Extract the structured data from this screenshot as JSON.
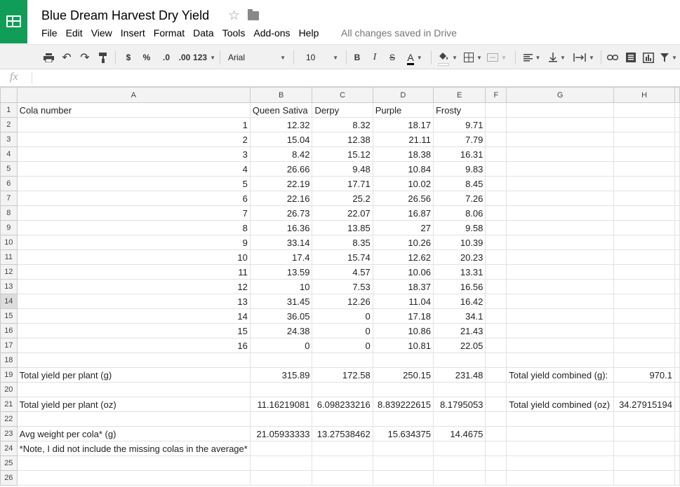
{
  "app": {
    "title": "Blue Dream Harvest Dry Yield",
    "save_status": "All changes saved in Drive"
  },
  "menu": [
    "File",
    "Edit",
    "View",
    "Insert",
    "Format",
    "Data",
    "Tools",
    "Add-ons",
    "Help"
  ],
  "toolbar": {
    "currency": "$",
    "percent": "%",
    "dec_less": ".0",
    "dec_more": ".00",
    "format_more": "123",
    "font": "Arial",
    "font_size": "10",
    "bold": "B",
    "italic": "I",
    "strike": "S",
    "text_color": "A",
    "text_color_value": "#000000"
  },
  "formula_bar": {
    "fx_label": "fx",
    "value": ""
  },
  "columns": [
    "A",
    "B",
    "C",
    "D",
    "E",
    "F",
    "G",
    "H"
  ],
  "rows": [
    {
      "n": "1",
      "cells": [
        "Cola number",
        "Queen Sativa",
        "Derpy",
        "Purple",
        "Frosty",
        "",
        "",
        ""
      ]
    },
    {
      "n": "2",
      "cells": [
        "1",
        "12.32",
        "8.32",
        "18.17",
        "9.71",
        "",
        "",
        ""
      ]
    },
    {
      "n": "3",
      "cells": [
        "2",
        "15.04",
        "12.38",
        "21.11",
        "7.79",
        "",
        "",
        ""
      ]
    },
    {
      "n": "4",
      "cells": [
        "3",
        "8.42",
        "15.12",
        "18.38",
        "16.31",
        "",
        "",
        ""
      ]
    },
    {
      "n": "5",
      "cells": [
        "4",
        "26.66",
        "9.48",
        "10.84",
        "9.83",
        "",
        "",
        ""
      ]
    },
    {
      "n": "6",
      "cells": [
        "5",
        "22.19",
        "17.71",
        "10.02",
        "8.45",
        "",
        "",
        ""
      ]
    },
    {
      "n": "7",
      "cells": [
        "6",
        "22.16",
        "25.2",
        "26.56",
        "7.26",
        "",
        "",
        ""
      ]
    },
    {
      "n": "8",
      "cells": [
        "7",
        "26.73",
        "22.07",
        "16.87",
        "8.06",
        "",
        "",
        ""
      ]
    },
    {
      "n": "9",
      "cells": [
        "8",
        "16.36",
        "13.85",
        "27",
        "9.58",
        "",
        "",
        ""
      ]
    },
    {
      "n": "10",
      "cells": [
        "9",
        "33.14",
        "8.35",
        "10.26",
        "10.39",
        "",
        "",
        ""
      ]
    },
    {
      "n": "11",
      "cells": [
        "10",
        "17.4",
        "15.74",
        "12.62",
        "20.23",
        "",
        "",
        ""
      ]
    },
    {
      "n": "12",
      "cells": [
        "11",
        "13.59",
        "4.57",
        "10.06",
        "13.31",
        "",
        "",
        ""
      ]
    },
    {
      "n": "13",
      "cells": [
        "12",
        "10",
        "7.53",
        "18.37",
        "16.56",
        "",
        "",
        ""
      ]
    },
    {
      "n": "14",
      "cells": [
        "13",
        "31.45",
        "12.26",
        "11.04",
        "16.42",
        "",
        "",
        ""
      ],
      "selected": true
    },
    {
      "n": "15",
      "cells": [
        "14",
        "36.05",
        "0",
        "17.18",
        "34.1",
        "",
        "",
        ""
      ]
    },
    {
      "n": "16",
      "cells": [
        "15",
        "24.38",
        "0",
        "10.86",
        "21.43",
        "",
        "",
        ""
      ]
    },
    {
      "n": "17",
      "cells": [
        "16",
        "0",
        "0",
        "10.81",
        "22.05",
        "",
        "",
        ""
      ]
    },
    {
      "n": "18",
      "cells": [
        "",
        "",
        "",
        "",
        "",
        "",
        "",
        ""
      ]
    },
    {
      "n": "19",
      "cells": [
        "Total yield per plant (g)",
        "315.89",
        "172.58",
        "250.15",
        "231.48",
        "",
        "Total yield combined (g):",
        "970.1"
      ]
    },
    {
      "n": "20",
      "cells": [
        "",
        "",
        "",
        "",
        "",
        "",
        "",
        ""
      ]
    },
    {
      "n": "21",
      "cells": [
        "Total yield per plant (oz)",
        "11.16219081",
        "6.098233216",
        "8.839222615",
        "8.1795053",
        "",
        "Total yield combined (oz)",
        "34.27915194"
      ]
    },
    {
      "n": "22",
      "cells": [
        "",
        "",
        "",
        "",
        "",
        "",
        "",
        ""
      ]
    },
    {
      "n": "23",
      "cells": [
        "Avg weight per cola* (g)",
        "21.05933333",
        "13.27538462",
        "15.634375",
        "14.4675",
        "",
        "",
        ""
      ]
    },
    {
      "n": "24",
      "cells": [
        "*Note, I did not include the missing colas in the average*",
        "",
        "",
        "",
        "",
        "",
        "",
        ""
      ]
    },
    {
      "n": "25",
      "cells": [
        "",
        "",
        "",
        "",
        "",
        "",
        "",
        ""
      ]
    },
    {
      "n": "26",
      "cells": [
        "",
        "",
        "",
        "",
        "",
        "",
        "",
        ""
      ]
    }
  ]
}
